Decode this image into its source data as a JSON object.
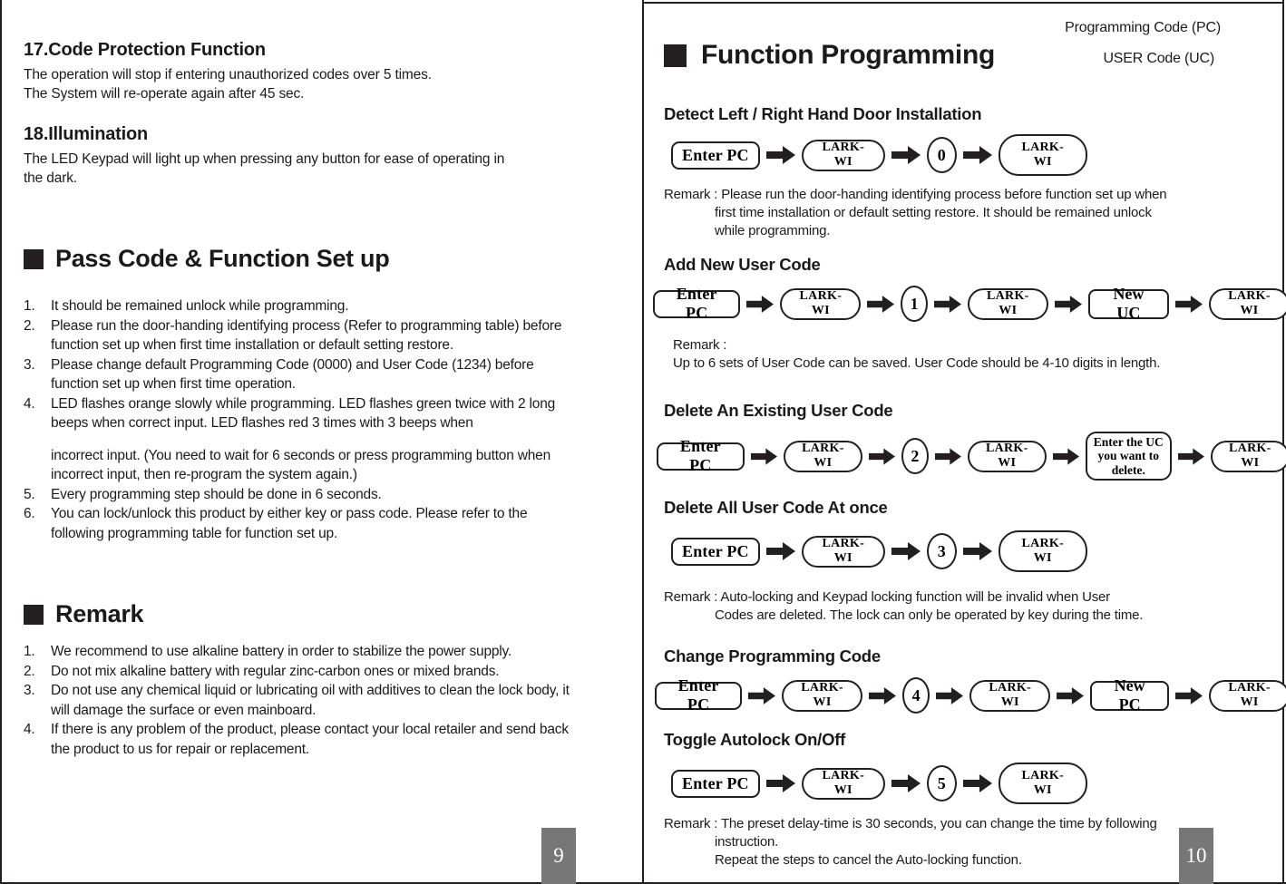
{
  "left_page": {
    "sections": [
      {
        "heading": "17.Code Protection Function",
        "lines": [
          "The operation will stop if entering unauthorized codes over 5 times.",
          "The System will re-operate again after 45 sec."
        ]
      },
      {
        "heading": "18.Illumination",
        "lines": [
          "The LED Keypad will light up when pressing any button for ease of operating in",
          "the dark."
        ]
      }
    ],
    "passcode_section": {
      "title": "Pass Code & Function Set up",
      "items": [
        "It should be remained unlock while programming.",
        "Please run the door-handing identifying process (Refer to programming table) before function set up when first time installation or default setting restore.",
        "Please change default Programming Code (0000) and User Code (1234) before function set up when first time operation.",
        "LED flashes orange slowly while programming. LED flashes green twice with 2 long beeps when correct input. LED flashes red 3 times with 3 beeps when",
        "incorrect input. (You need to wait for 6 seconds or press programming button when incorrect input, then re-program the system again.)",
        "Every programming step should be done in 6 seconds.",
        "You can lock/unlock this product by either key or pass code. Please refer to the following programming table for function set up."
      ],
      "markers": [
        "1.",
        "2.",
        "3.",
        "4.",
        "",
        "5.",
        "6."
      ]
    },
    "remark_section": {
      "title": "Remark",
      "items": [
        "We recommend to use alkaline battery in order to stabilize the power supply.",
        "Do not mix alkaline battery with regular zinc-carbon ones or mixed brands.",
        "Do not use any chemical liquid or lubricating oil with additives to clean the lock body, it will damage the surface or even mainboard.",
        "If there is any problem of the product, please contact your local retailer and send back the product to us for repair or replacement."
      ],
      "markers": [
        "1.",
        "2.",
        "3.",
        "4."
      ]
    },
    "page_number": "9"
  },
  "right_page": {
    "title": "Function Programming",
    "code_legend": {
      "programming_code": "Programming Code (PC)",
      "user_code": "USER Code (UC)"
    },
    "flows": [
      {
        "heading": "Detect Left / Right Hand Door Installation",
        "nodes": [
          {
            "type": "pc",
            "label": "Enter PC"
          },
          {
            "type": "pill",
            "label": "LARK-WI"
          },
          {
            "type": "circ",
            "label": "0"
          },
          {
            "type": "pill_tall",
            "label": "LARK-WI"
          }
        ],
        "remark_label": "Remark :",
        "remark_lines": [
          "Please run the door-handing identifying process before function set up when",
          "first time installation or default setting restore. It should be remained unlock",
          "while programming."
        ]
      },
      {
        "heading": "Add New User Code",
        "nodes": [
          {
            "type": "pc",
            "label": "Enter PC"
          },
          {
            "type": "pill",
            "label": "LARK-WI"
          },
          {
            "type": "circ",
            "label": "1"
          },
          {
            "type": "pill",
            "label": "LARK-WI"
          },
          {
            "type": "newbox",
            "label": "New UC"
          },
          {
            "type": "pill",
            "label": "LARK-WI"
          }
        ],
        "remark_label": "Remark :",
        "remark_lines": [
          "Up to 6 sets of User Code can be saved. User Code should be 4-10 digits in length."
        ]
      },
      {
        "heading": "Delete An Existing User Code",
        "nodes": [
          {
            "type": "pc",
            "label": "Enter PC"
          },
          {
            "type": "pill",
            "label": "LARK-WI"
          },
          {
            "type": "circ",
            "label": "2"
          },
          {
            "type": "pill",
            "label": "LARK-WI"
          },
          {
            "type": "multi",
            "label": "Enter the UC you want to delete."
          },
          {
            "type": "pill",
            "label": "LARK-WI"
          }
        ],
        "remark_label": "",
        "remark_lines": []
      },
      {
        "heading": "Delete All User Code At once",
        "nodes": [
          {
            "type": "pc",
            "label": "Enter PC"
          },
          {
            "type": "pill",
            "label": "LARK-WI"
          },
          {
            "type": "circ",
            "label": "3"
          },
          {
            "type": "pill",
            "label": "LARK-WI"
          }
        ],
        "remark_label": "Remark :",
        "remark_lines": [
          "Auto-locking and Keypad locking function will be invalid when User",
          "Codes are deleted. The lock can only be operated by key during the time."
        ]
      },
      {
        "heading": "Change Programming Code",
        "nodes": [
          {
            "type": "pc",
            "label": "Enter PC"
          },
          {
            "type": "pill",
            "label": "LARK-WI"
          },
          {
            "type": "circ",
            "label": "4"
          },
          {
            "type": "pill",
            "label": "LARK-WI"
          },
          {
            "type": "newbox",
            "label": "New PC"
          },
          {
            "type": "pill",
            "label": "LARK-WI"
          }
        ],
        "remark_label": "",
        "remark_lines": []
      },
      {
        "heading": "Toggle Autolock On/Off",
        "nodes": [
          {
            "type": "pc",
            "label": "Enter PC"
          },
          {
            "type": "pill",
            "label": "LARK-WI"
          },
          {
            "type": "circ",
            "label": "5"
          },
          {
            "type": "pill",
            "label": "LARK-WI"
          }
        ],
        "remark_label": "Remark :",
        "remark_lines": [
          "The preset delay-time is 30 seconds, you can change the time by following",
          "instruction.",
          "Repeat the steps to cancel the Auto-locking function."
        ]
      }
    ],
    "page_number": "10"
  },
  "colors": {
    "ink": "#231f20",
    "page_chip_bg": "#777777",
    "page_chip_fg": "#ffffff",
    "paper": "#ffffff"
  }
}
